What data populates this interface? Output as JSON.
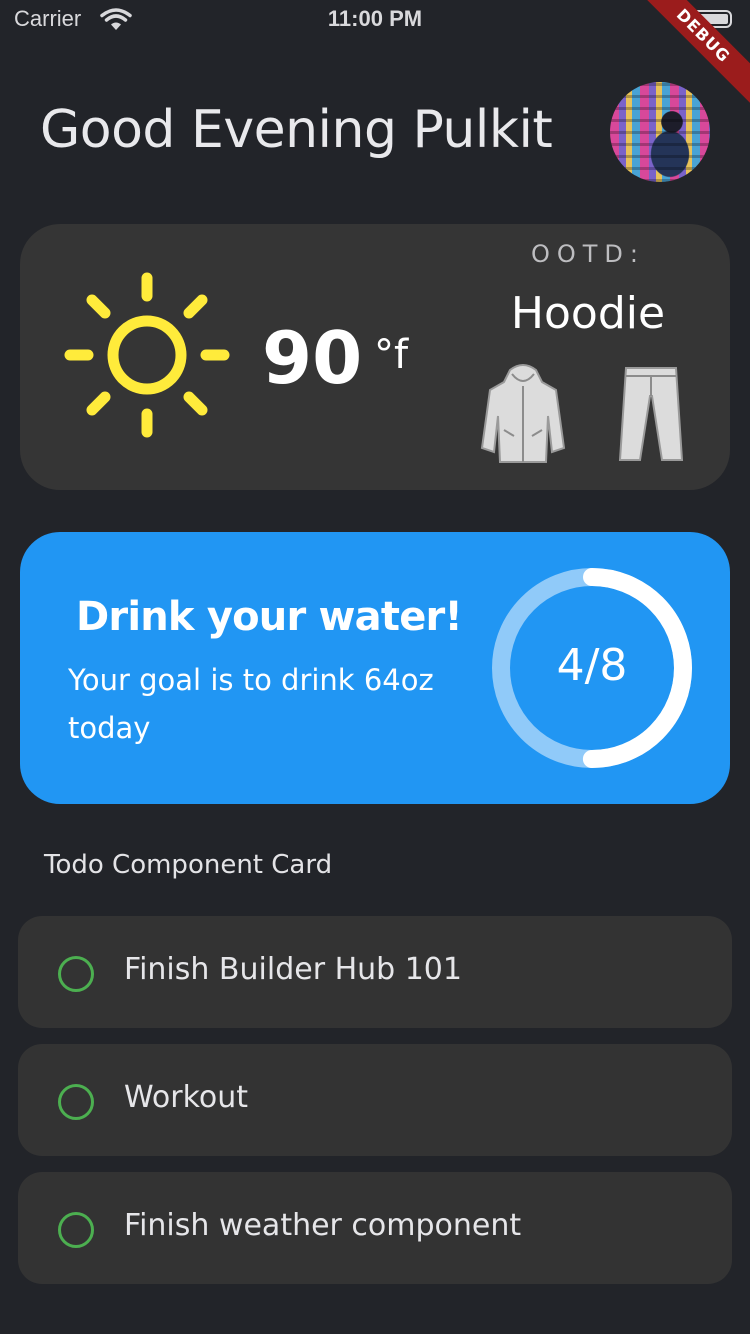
{
  "status_bar": {
    "carrier": "Carrier",
    "time": "11:00 PM",
    "debug_badge": "DEBUG"
  },
  "header": {
    "greeting": "Good Evening Pulkit"
  },
  "weather": {
    "icon": "sun-icon",
    "temperature": "90",
    "unit": "°f",
    "ootd_label": "OOTD:",
    "ootd_value": "Hoodie",
    "outfit_icons": [
      "hoodie-icon",
      "pants-icon"
    ],
    "sun_color": "#ffeb3b"
  },
  "water": {
    "title": "Drink your water!",
    "subtitle": "Your goal is to drink 64oz today",
    "progress_text": "4/8",
    "progress_fraction": 0.5,
    "card_color": "#2196f3"
  },
  "todos": {
    "heading": "Todo Component Card",
    "check_color": "#4caf50",
    "items": [
      {
        "label": "Finish Builder Hub 101"
      },
      {
        "label": "Workout"
      },
      {
        "label": "Finish weather component"
      }
    ]
  }
}
